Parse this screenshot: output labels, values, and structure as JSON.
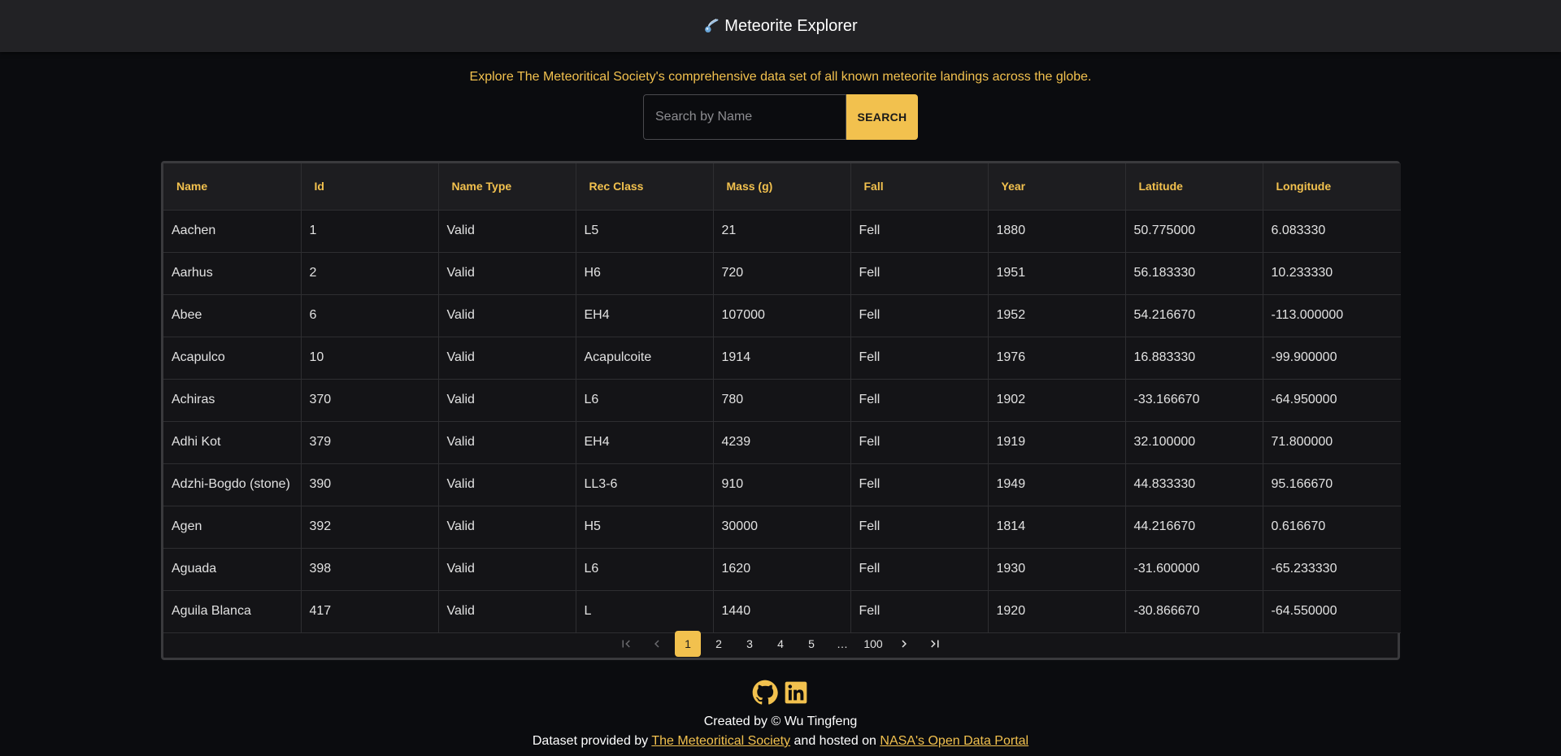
{
  "header": {
    "title": "Meteorite Explorer",
    "logo_icon": "comet-icon"
  },
  "tagline": "Explore The Meteoritical Society's comprehensive data set of all known meteorite landings across the globe.",
  "search": {
    "placeholder": "Search by Name",
    "value": "",
    "button_label": "SEARCH"
  },
  "table": {
    "columns": [
      "Name",
      "Id",
      "Name Type",
      "Rec Class",
      "Mass (g)",
      "Fall",
      "Year",
      "Latitude",
      "Longitude"
    ],
    "rows": [
      [
        "Aachen",
        "1",
        "Valid",
        "L5",
        "21",
        "Fell",
        "1880",
        "50.775000",
        "6.083330"
      ],
      [
        "Aarhus",
        "2",
        "Valid",
        "H6",
        "720",
        "Fell",
        "1951",
        "56.183330",
        "10.233330"
      ],
      [
        "Abee",
        "6",
        "Valid",
        "EH4",
        "107000",
        "Fell",
        "1952",
        "54.216670",
        "-113.000000"
      ],
      [
        "Acapulco",
        "10",
        "Valid",
        "Acapulcoite",
        "1914",
        "Fell",
        "1976",
        "16.883330",
        "-99.900000"
      ],
      [
        "Achiras",
        "370",
        "Valid",
        "L6",
        "780",
        "Fell",
        "1902",
        "-33.166670",
        "-64.950000"
      ],
      [
        "Adhi Kot",
        "379",
        "Valid",
        "EH4",
        "4239",
        "Fell",
        "1919",
        "32.100000",
        "71.800000"
      ],
      [
        "Adzhi-Bogdo (stone)",
        "390",
        "Valid",
        "LL3-6",
        "910",
        "Fell",
        "1949",
        "44.833330",
        "95.166670"
      ],
      [
        "Agen",
        "392",
        "Valid",
        "H5",
        "30000",
        "Fell",
        "1814",
        "44.216670",
        "0.616670"
      ],
      [
        "Aguada",
        "398",
        "Valid",
        "L6",
        "1620",
        "Fell",
        "1930",
        "-31.600000",
        "-65.233330"
      ],
      [
        "Aguila Blanca",
        "417",
        "Valid",
        "L",
        "1440",
        "Fell",
        "1920",
        "-30.866670",
        "-64.550000"
      ]
    ]
  },
  "pagination": {
    "first_icon": "first-page-icon",
    "prev_icon": "chevron-left-icon",
    "pages": [
      "1",
      "2",
      "3",
      "4",
      "5",
      "…",
      "100"
    ],
    "current": "1",
    "next_icon": "chevron-right-icon",
    "last_icon": "last-page-icon"
  },
  "footer": {
    "social_icons": [
      "github-icon",
      "linkedin-icon"
    ],
    "credit": "Created by © Wu Tingfeng",
    "dataset_prefix": "Dataset provided by",
    "dataset_link1": "The Meteoritical Society",
    "dataset_mid": "and hosted on",
    "dataset_link2": "NASA's Open Data Portal"
  },
  "colors": {
    "accent": "#f2c14e",
    "background": "#0b0c0f",
    "header_bg": "#222225",
    "table_bg": "#141417"
  }
}
